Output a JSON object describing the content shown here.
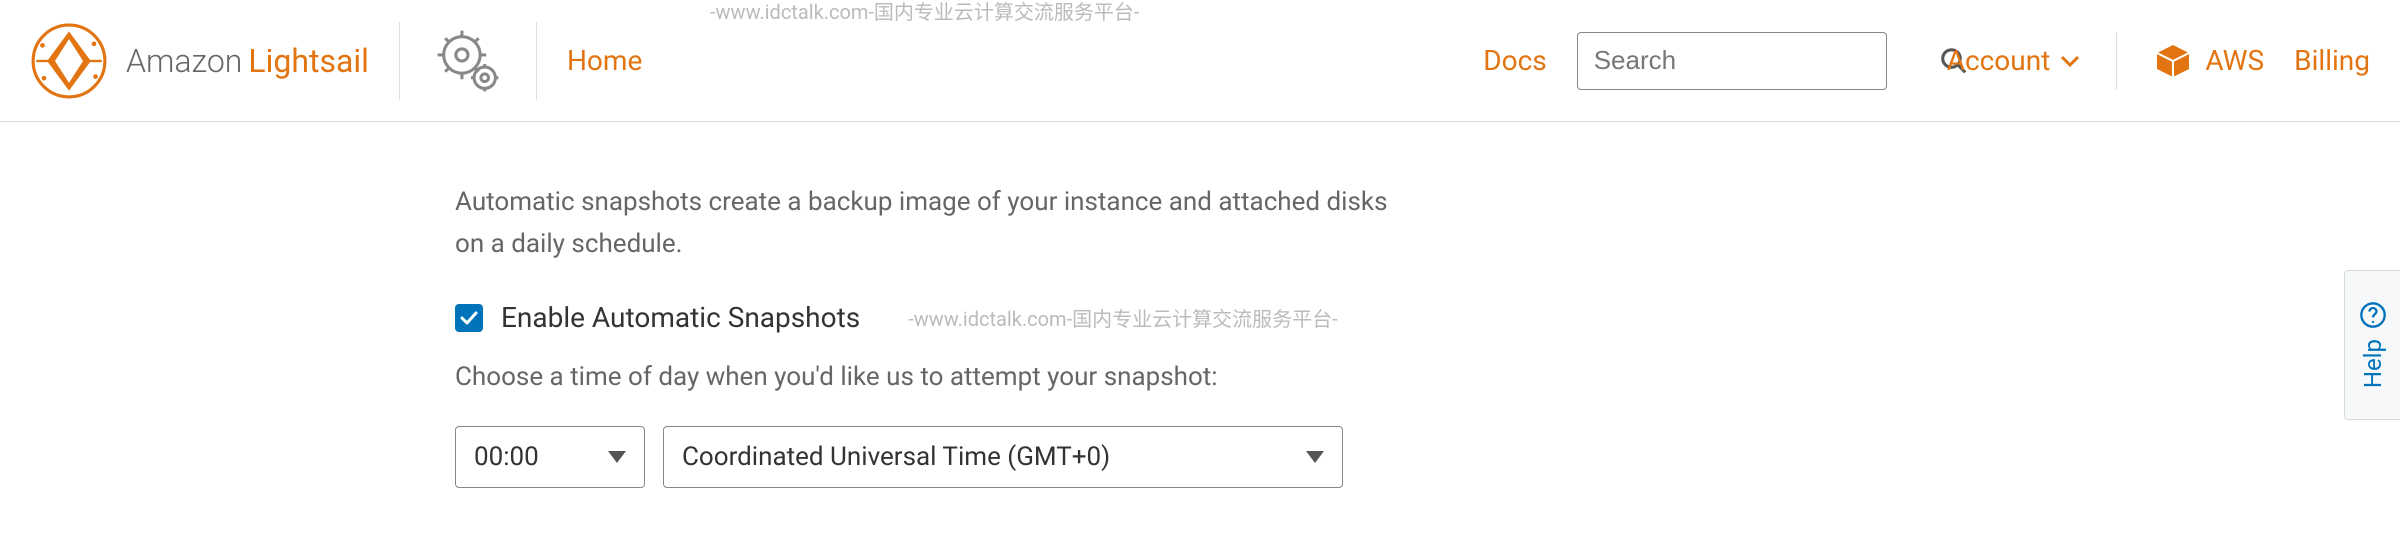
{
  "header": {
    "brand_amazon": "Amazon",
    "brand_lightsail": "Lightsail",
    "home_label": "Home",
    "docs_label": "Docs",
    "search_placeholder": "Search",
    "account_label": "Account",
    "aws_label": "AWS",
    "billing_label": "Billing"
  },
  "main": {
    "description": "Automatic snapshots create a backup image of your instance and attached disks on a daily schedule.",
    "enable_label": "Enable Automatic Snapshots",
    "enable_checked": true,
    "choose_text": "Choose a time of day when you'd like us to attempt your snapshot:",
    "time_value": "00:00",
    "timezone_value": "Coordinated Universal Time (GMT+0)"
  },
  "help_tab": {
    "label": "Help"
  },
  "watermarks": {
    "top": "-www.idctalk.com-国内专业云计算交流服务平台-",
    "mid": "-www.idctalk.com-国内专业云计算交流服务平台-"
  },
  "colors": {
    "accent": "#e27512",
    "link_blue": "#0073bb"
  }
}
